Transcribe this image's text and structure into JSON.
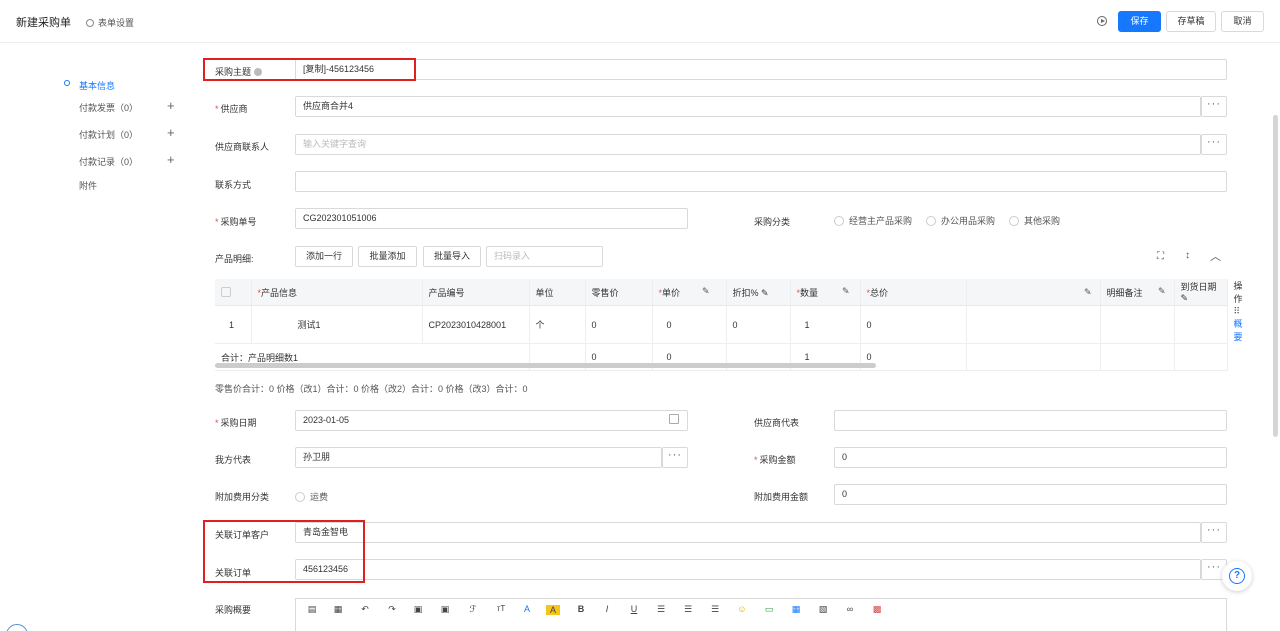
{
  "header": {
    "title": "新建采购单",
    "form_settings": "表单设置",
    "save": "保存",
    "draft": "存草稿",
    "cancel": "取消"
  },
  "sidebar": {
    "items": [
      {
        "label": "基本信息"
      },
      {
        "label": "付款发票（0）"
      },
      {
        "label": "付款计划（0）"
      },
      {
        "label": "付款记录（0）"
      },
      {
        "label": "附件"
      }
    ]
  },
  "form": {
    "subject": {
      "label": "采购主题",
      "value": "[复制]-456123456"
    },
    "supplier": {
      "label": "供应商",
      "value": "供应商合并4"
    },
    "supplier_contact": {
      "label": "供应商联系人",
      "placeholder": "输入关键字查询"
    },
    "contact_method": {
      "label": "联系方式",
      "value": ""
    },
    "order_no": {
      "label": "采购单号",
      "value": "CG202301051006"
    },
    "category": {
      "label": "采购分类",
      "options": [
        "经营主产品采购",
        "办公用品采购",
        "其他采购"
      ]
    },
    "product_detail": {
      "label": "产品明细:",
      "add_row": "添加一行",
      "batch_add": "批量添加",
      "batch_import": "批量导入",
      "scan_placeholder": "扫码录入"
    },
    "purchase_date": {
      "label": "采购日期",
      "value": "2023-01-05"
    },
    "supplier_rep": {
      "label": "供应商代表",
      "value": ""
    },
    "our_rep": {
      "label": "我方代表",
      "value": "孙卫朋"
    },
    "purchase_amount": {
      "label": "采购金额",
      "value": "0"
    },
    "extra_fee_category": {
      "label": "附加费用分类",
      "option": "运费"
    },
    "extra_fee_amount": {
      "label": "附加费用金额",
      "value": "0"
    },
    "linked_customer": {
      "label": "关联订单客户",
      "value": "青岛金智电"
    },
    "linked_order": {
      "label": "关联订单",
      "value": "456123456"
    },
    "summary": {
      "label": "采购概要"
    }
  },
  "table": {
    "headers": [
      "产品信息",
      "产品编号",
      "单位",
      "零售价",
      "单价",
      "折扣%",
      "数量",
      "总价",
      "明细备注",
      "到货日期",
      "操作"
    ],
    "rows": [
      {
        "index": "1",
        "product": "测试1",
        "code": "CP2023010428001",
        "unit": "个",
        "retail": "0",
        "price": "0",
        "discount": "0",
        "qty": "1",
        "total": "0",
        "note": "",
        "date": "",
        "action": "概要"
      }
    ],
    "sum": {
      "label": "合计：产品明细数1",
      "retail": "0",
      "price": "0",
      "qty": "1",
      "total": "0"
    }
  },
  "totals_line": "零售价合计：0  价格（改1）合计：0  价格（改2）合计：0  价格（改3）合计：0",
  "colors": {
    "accent": "#1677ff",
    "required": "#e34d4d",
    "highlight": "#e02020"
  }
}
